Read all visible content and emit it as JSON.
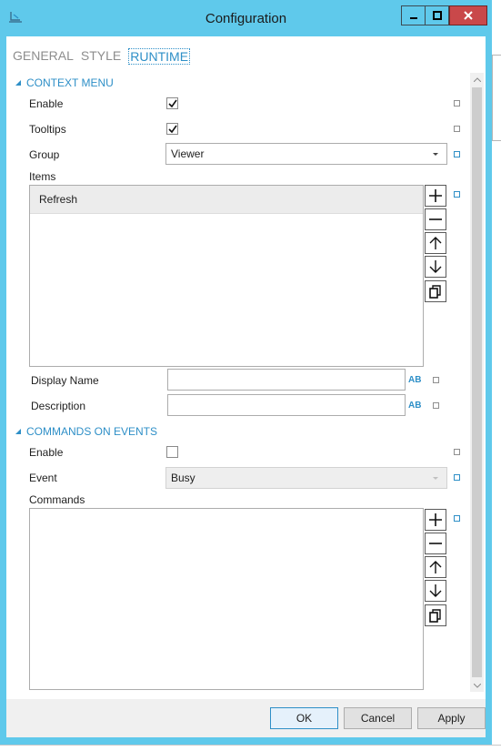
{
  "window": {
    "title": "Configuration",
    "buttons": {
      "minimize": "minimize-icon",
      "maximize": "maximize-icon",
      "close": "close-icon"
    }
  },
  "tabs": [
    {
      "label": "GENERAL",
      "active": false
    },
    {
      "label": "STYLE",
      "active": false
    },
    {
      "label": "RUNTIME",
      "active": true
    }
  ],
  "context_menu": {
    "header": "CONTEXT MENU",
    "enable": {
      "label": "Enable",
      "checked": true
    },
    "tooltips": {
      "label": "Tooltips",
      "checked": true
    },
    "group": {
      "label": "Group",
      "value": "Viewer"
    },
    "items": {
      "label": "Items",
      "list": [
        "Refresh"
      ]
    },
    "display_name": {
      "label": "Display Name",
      "value": ""
    },
    "description": {
      "label": "Description",
      "value": ""
    }
  },
  "commands_on_events": {
    "header": "COMMANDS ON EVENTS",
    "enable": {
      "label": "Enable",
      "checked": false
    },
    "event": {
      "label": "Event",
      "value": "Busy"
    },
    "commands": {
      "label": "Commands",
      "list": []
    }
  },
  "footer": {
    "ok": "OK",
    "cancel": "Cancel",
    "apply": "Apply"
  },
  "colors": {
    "titlebar": "#5fc9eb",
    "accent": "#2e8fc7",
    "close_button": "#c9484a"
  },
  "icons": {
    "ab": "AB",
    "add": "add-icon",
    "remove": "remove-icon",
    "move_up": "arrow-up-icon",
    "move_down": "arrow-down-icon",
    "duplicate": "copy-icon"
  }
}
